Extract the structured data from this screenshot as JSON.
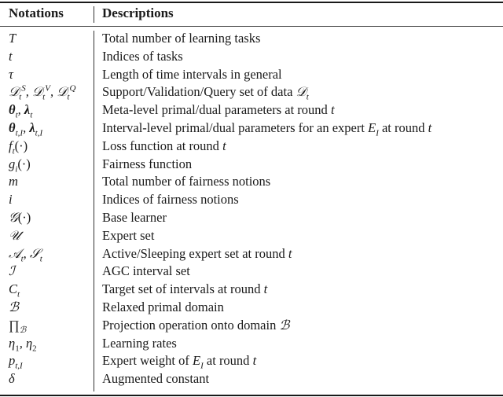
{
  "table": {
    "headers": {
      "notation": "Notations",
      "description": "Descriptions"
    },
    "rows": [
      {
        "notation_html": "T",
        "description_html": "Total number of learning tasks"
      },
      {
        "notation_html": "t",
        "description_html": "Indices of tasks"
      },
      {
        "notation_html": "τ",
        "description_html": "Length of time intervals in general"
      },
      {
        "notation_html": "<span class='cal'>𝒟</span><sub>t</sub><sup>S</sup>, <span class='cal'>𝒟</span><sub>t</sub><sup>V</sup>, <span class='cal'>𝒟</span><sub>t</sub><sup>Q</sup>",
        "description_html": "Support/Validation/Query set of data <i><span class='cal'>𝒟</span><sub>t</sub></i>"
      },
      {
        "notation_html": "<span class='bold-sym'>θ</span><sub>t</sub>, <span class='bold-sym'>λ</span><sub>t</sub>",
        "description_html": "Meta-level primal/dual parameters at round <i>t</i>"
      },
      {
        "notation_html": "<span class='bold-sym'>θ</span><sub>t,I</sub>, <span class='bold-sym'>λ</span><sub>t,I</sub>",
        "description_html": "Interval-level primal/dual parameters for an expert <i>E<sub>I</sub></i> at round <i>t</i>"
      },
      {
        "notation_html": "f<sub>t</sub><span class='upright'>(·)</span>",
        "description_html": "Loss function at round <i>t</i>"
      },
      {
        "notation_html": "g<sub>i</sub><span class='upright'>(·)</span>",
        "description_html": "Fairness function"
      },
      {
        "notation_html": "m",
        "description_html": "Total number of fairness notions"
      },
      {
        "notation_html": "i",
        "description_html": "Indices of fairness notions"
      },
      {
        "notation_html": "<span class='cal'>𝒢</span><span class='upright'>(·)</span>",
        "description_html": "Base learner"
      },
      {
        "notation_html": "<span class='cal'>𝒰</span>",
        "description_html": "Expert set"
      },
      {
        "notation_html": "<span class='cal'>𝒜</span><sub>t</sub>, <span class='cal'>𝒮</span><sub>t</sub>",
        "description_html": "Active/Sleeping expert set at round <i>t</i>"
      },
      {
        "notation_html": "<span class='cal'>ℐ</span>",
        "description_html": "AGC interval set"
      },
      {
        "notation_html": "C<sub>t</sub>",
        "description_html": "Target set of intervals at round <i>t</i>"
      },
      {
        "notation_html": "<span class='cal'>ℬ</span>",
        "description_html": "Relaxed primal domain"
      },
      {
        "notation_html": "<span class='upright'>∏</span><sub><span class='cal'>ℬ</span></sub>",
        "description_html": "Projection operation onto domain <i><span class='cal'>ℬ</span></i>"
      },
      {
        "notation_html": "η<sub class='upright'>1</sub>, η<sub class='upright'>2</sub>",
        "description_html": "Learning rates"
      },
      {
        "notation_html": "p<sub>t,I</sub>",
        "description_html": "Expert weight of <i>E<sub>I</sub></i> at round <i>t</i>"
      },
      {
        "notation_html": "δ",
        "description_html": "Augmented constant"
      }
    ]
  }
}
